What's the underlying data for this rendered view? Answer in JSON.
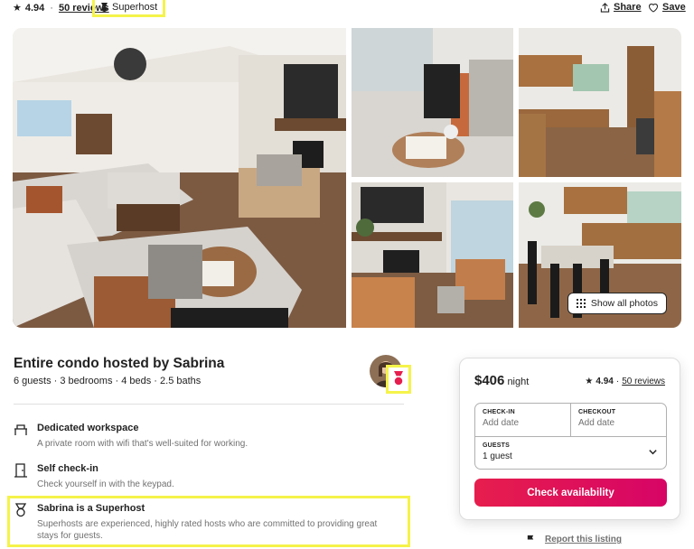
{
  "header": {
    "rating_value": "4.94",
    "reviews_link": "50 reviews",
    "superhost_badge": "Superhost",
    "share_label": "Share",
    "save_label": "Save"
  },
  "gallery": {
    "show_all_label": "Show all photos"
  },
  "listing": {
    "title": "Entire condo hosted by Sabrina",
    "summary": "6 guests · 3 bedrooms · 4 beds · 2.5 baths"
  },
  "features": [
    {
      "icon": "workspace-icon",
      "title": "Dedicated workspace",
      "desc": "A private room with wifi that's well-suited for working."
    },
    {
      "icon": "door-icon",
      "title": "Self check-in",
      "desc": "Check yourself in with the keypad."
    },
    {
      "icon": "superhost-medal-icon",
      "title": "Sabrina is a Superhost",
      "desc": "Superhosts are experienced, highly rated hosts who are committed to providing great stays for guests."
    }
  ],
  "booking": {
    "price": "$406",
    "price_unit": "night",
    "rating_value": "4.94",
    "reviews_link": "50 reviews",
    "checkin_label": "CHECK-IN",
    "checkin_value": "Add date",
    "checkout_label": "CHECKOUT",
    "checkout_value": "Add date",
    "guests_label": "GUESTS",
    "guests_value": "1 guest",
    "cta_label": "Check availability"
  },
  "report": {
    "label": "Report this listing"
  },
  "colors": {
    "accent": "#e61e4d",
    "highlight": "#f5f34a",
    "text": "#222222",
    "muted": "#717171"
  }
}
